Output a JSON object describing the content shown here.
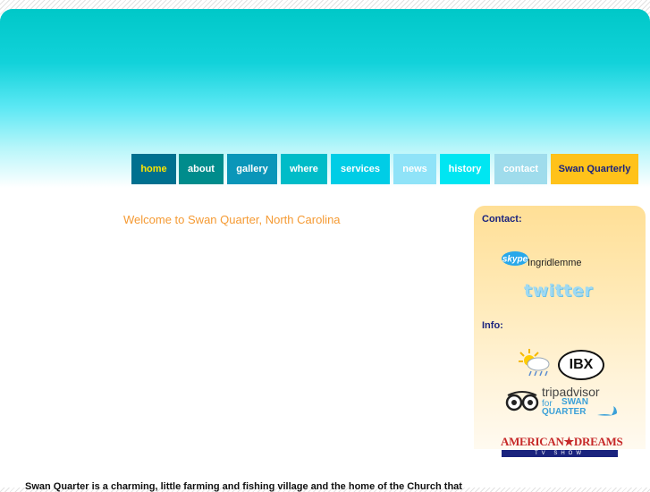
{
  "nav": {
    "items": [
      {
        "label": "home",
        "bg": "#00708f",
        "color": "#ffe600"
      },
      {
        "label": "about",
        "bg": "#008c8c",
        "color": "#ffffff"
      },
      {
        "label": "gallery",
        "bg": "#0a96b9",
        "color": "#ffffff"
      },
      {
        "label": "where",
        "bg": "#00bcc8",
        "color": "#ffffff"
      },
      {
        "label": "services",
        "bg": "#00cde6",
        "color": "#ffffff"
      },
      {
        "label": "news",
        "bg": "#8fe3f8",
        "color": "#ffffff"
      },
      {
        "label": "history",
        "bg": "#00e6f2",
        "color": "#ffffff"
      },
      {
        "label": "contact",
        "bg": "#9fdcec",
        "color": "#ffffff"
      },
      {
        "label": "Swan Quarterly",
        "bg": "#ffc21a",
        "color": "#1a237e"
      }
    ]
  },
  "main": {
    "welcome": "Welcome to Swan Quarter, North Carolina",
    "intro": "Swan Quarter is a charming, little farming and fishing village and the home of the Church that"
  },
  "sidebar": {
    "contact_heading": "Contact:",
    "skype_logo": "skype",
    "skype_name": "Ingridlemme",
    "twitter_logo": "twitter",
    "info_heading": "Info:",
    "ibx_logo": "IBX",
    "tripadvisor": {
      "brand": "tripadvisor",
      "for": "for",
      "line1": "SWAN",
      "line2": "QUARTER"
    },
    "american_dreams": {
      "title": "AMERICAN★DREAMS",
      "tagline": "TV SHOW"
    }
  }
}
